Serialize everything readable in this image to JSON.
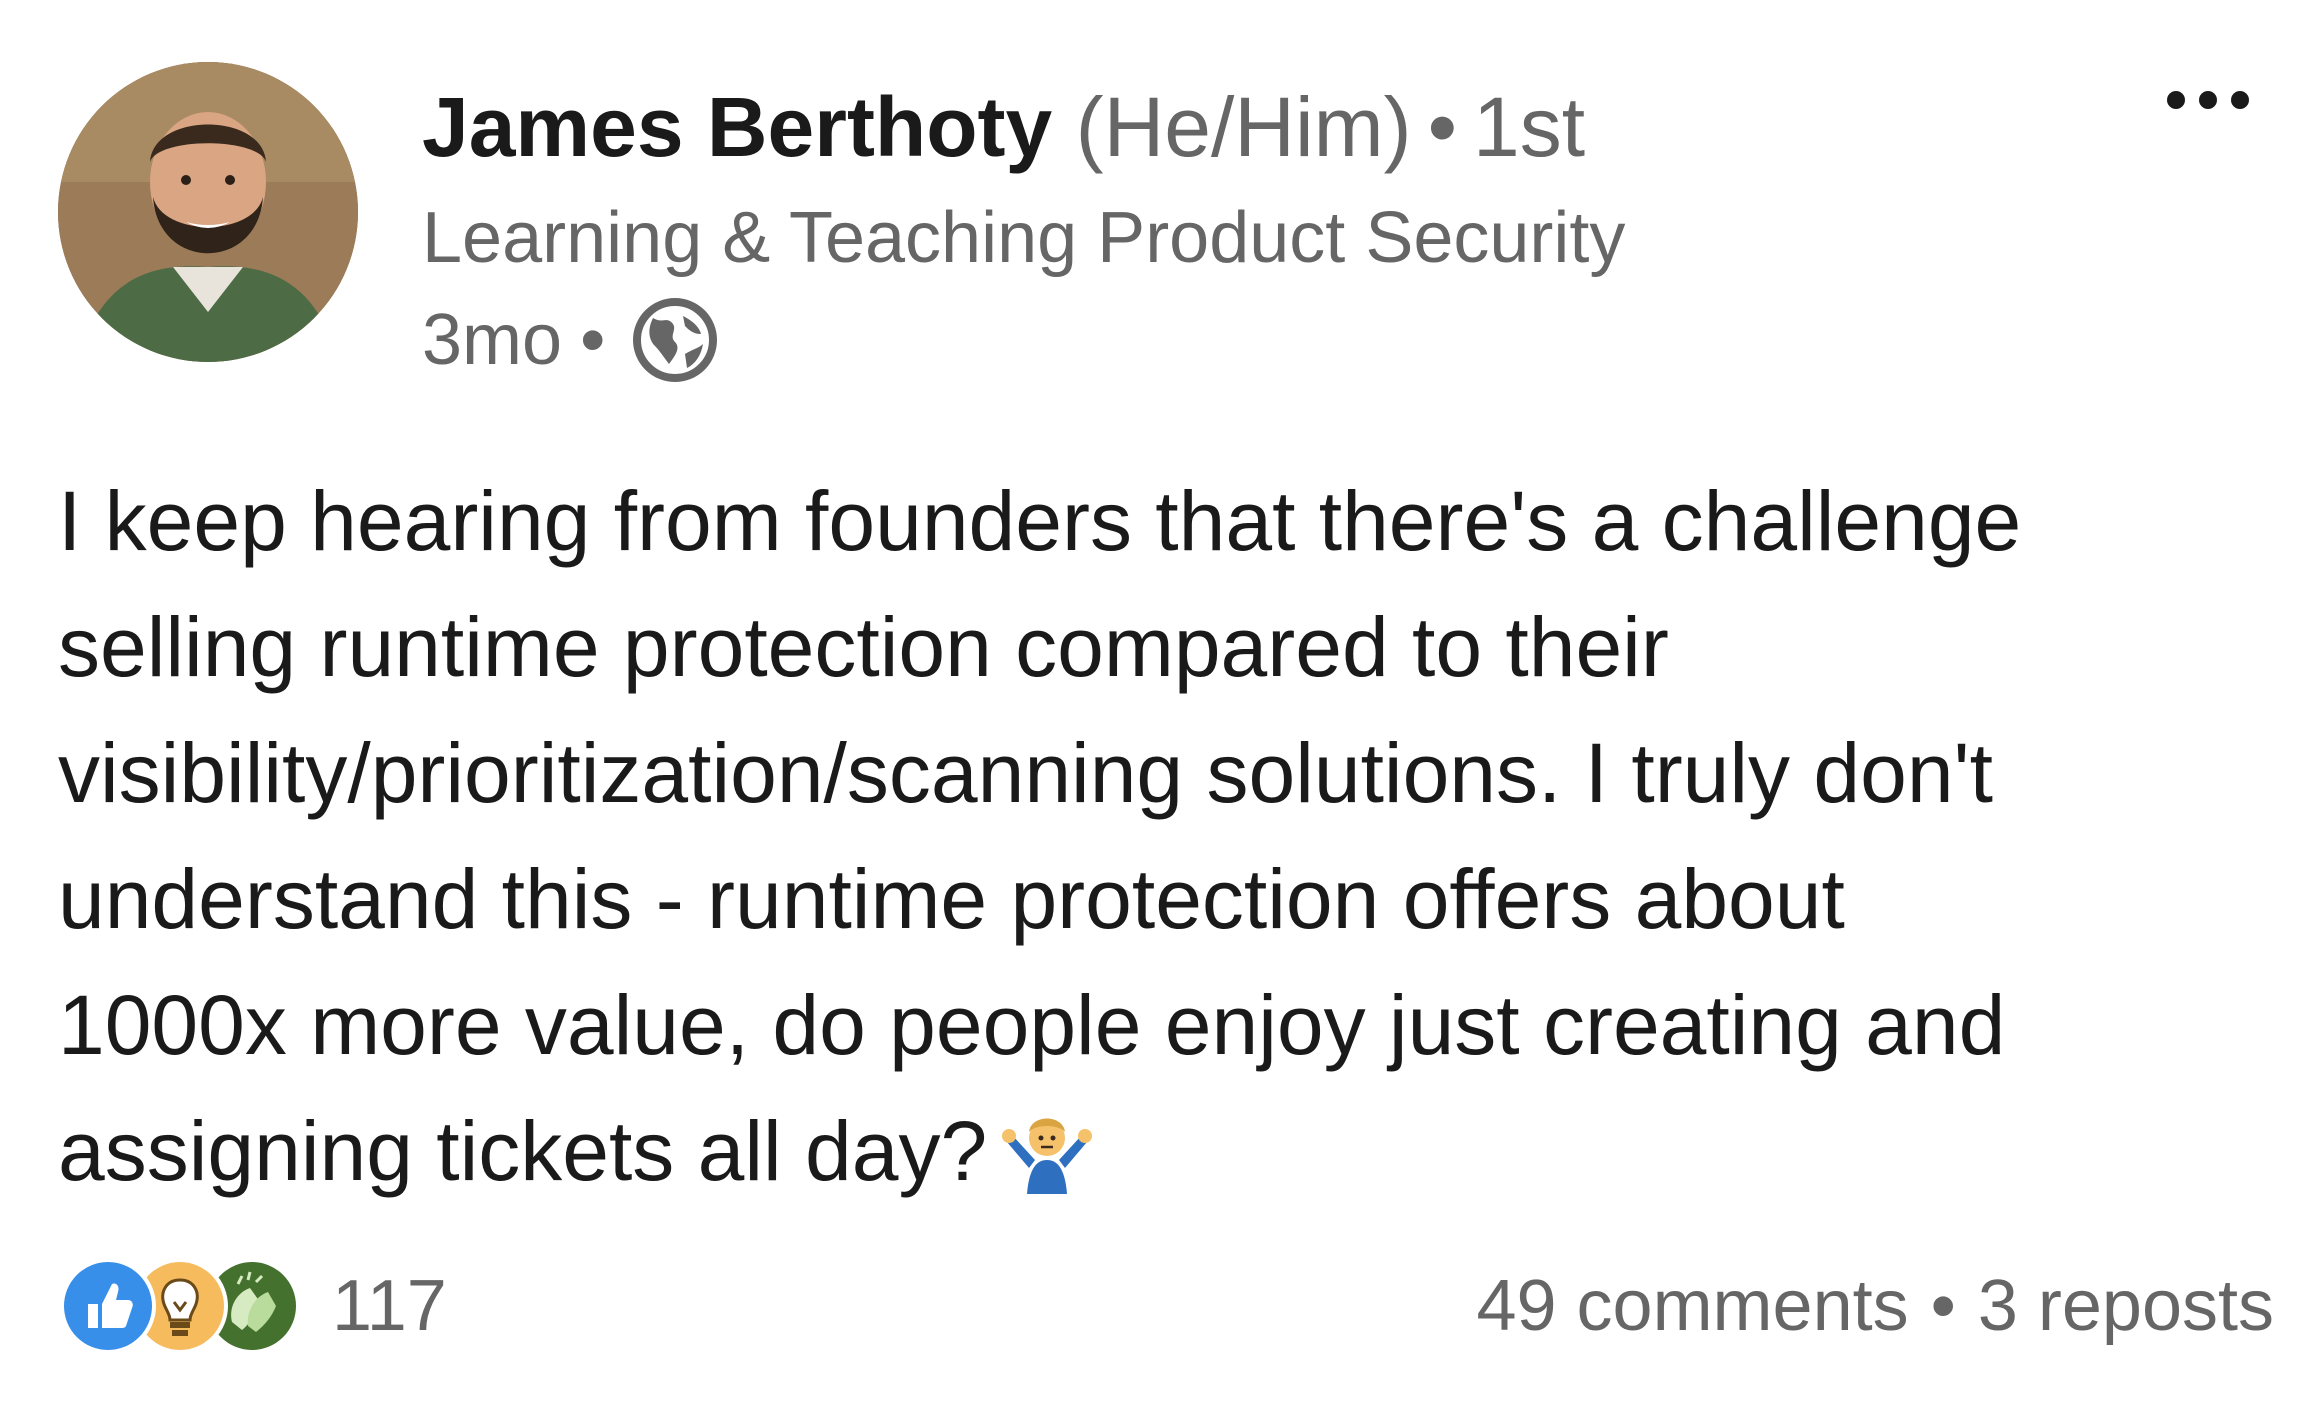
{
  "author": {
    "name": "James Berthoty",
    "pronouns": "(He/Him)",
    "separator": "•",
    "connection_degree": "1st",
    "headline": "Learning & Teaching Product Security",
    "time_ago": "3mo",
    "time_separator": "•",
    "visibility_icon": "globe-icon"
  },
  "menu": {
    "icon": "more-horizontal-icon"
  },
  "post": {
    "lines": [
      "I keep hearing from founders that there's a challenge",
      "selling runtime protection compared to their",
      "visibility/prioritization/scanning solutions. I truly don't",
      "understand this - runtime protection offers about",
      "1000x more value, do people enjoy just creating and",
      "assigning tickets all day?"
    ],
    "emoji_icon": "person-shrugging-emoji"
  },
  "social": {
    "reaction_icons": [
      "like-icon",
      "insightful-icon",
      "celebrate-icon"
    ],
    "reaction_count": "117",
    "comments": "49 comments",
    "separator": "•",
    "reposts": "3 reposts"
  },
  "colors": {
    "like": "#378fe9",
    "insightful": "#f5bb5c",
    "celebrate": "#44712e",
    "secondary_text": "#666666",
    "primary_text": "#1a1a1a"
  }
}
